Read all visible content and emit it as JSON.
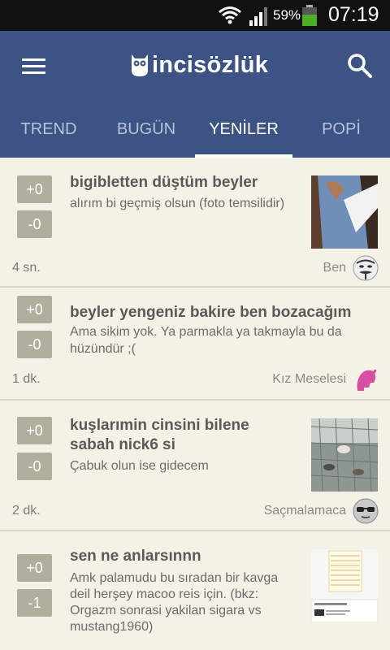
{
  "status_bar": {
    "battery_text": "59%",
    "time": "07:19",
    "icons": [
      "wifi-icon",
      "signal-icon",
      "battery-icon"
    ]
  },
  "app": {
    "logo_text": "incisözlük",
    "colors": {
      "appbar": "#3d5383",
      "background": "#f4f1e6",
      "vote_button": "#b2ae9e"
    }
  },
  "tabs": [
    {
      "label": "TREND",
      "active": false
    },
    {
      "label": "BUGÜN",
      "active": false
    },
    {
      "label": "YENİLER",
      "active": true
    },
    {
      "label": "POPİ",
      "active": false
    }
  ],
  "entries": [
    {
      "plus": "+0",
      "minus": "-0",
      "title": "bigibletten düştüm beyler",
      "body": "alırım bi geçmiş olsun (foto temsilidir)",
      "time": "4 sn.",
      "channel": "Ben",
      "avatar_icon": "mask-icon",
      "has_thumb": true
    },
    {
      "plus": "+0",
      "minus": "-0",
      "title": "beyler yengeniz bakire ben bozacağım",
      "body_lines": [
        "Ama sikim yok. Ya parmakla ya takmayla bu da",
        "hüzündür ;("
      ],
      "time": "1 dk.",
      "channel": "Kız Meselesi",
      "avatar_icon": "girl-silhouette-icon",
      "has_thumb": false
    },
    {
      "plus": "+0",
      "minus": "-0",
      "title_lines": [
        "kuşlarımin cinsini bilene",
        "sabah nick6 si"
      ],
      "body": "Çabuk olun ise gidecem",
      "time": "2 dk.",
      "channel": "Saçmalamaca",
      "avatar_icon": "sunglasses-face-icon",
      "has_thumb": true
    },
    {
      "plus": "+0",
      "minus": "-1",
      "title": "sen ne anlarsınnn",
      "body_lines": [
        "Amk palamudu bu sıradan bir kavga",
        "deil herşey macoo reis için. (bkz:",
        "Orgazm sonrasi yakilan sigara vs",
        "mustang1960)"
      ],
      "has_thumb": true
    }
  ]
}
